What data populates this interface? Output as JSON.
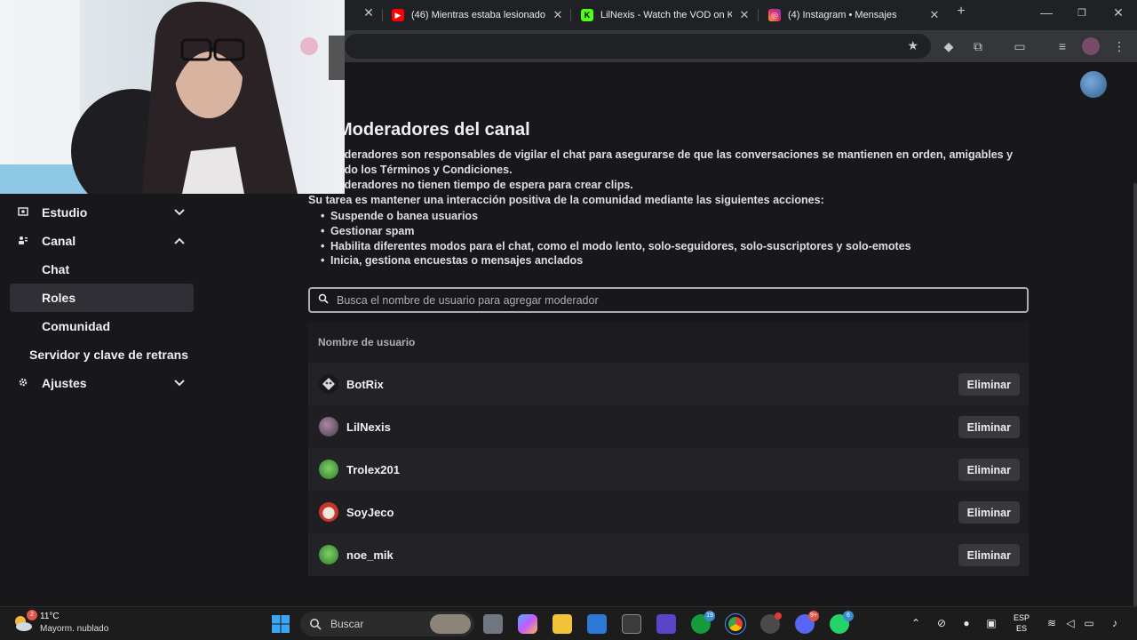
{
  "browser": {
    "tabs": [
      {
        "title": "(46) Mientras estaba lesionado",
        "favicon": "youtube-icon",
        "color": "#ff0000"
      },
      {
        "title": "LilNexis - Watch the VOD on Ki",
        "favicon": "kick-icon",
        "color": "#53fc18"
      },
      {
        "title": "(4) Instagram • Mensajes",
        "favicon": "instagram-icon",
        "color": "#e1306c"
      }
    ],
    "new_tab": "+",
    "window_controls": [
      "minimize-icon",
      "restore-icon",
      "close-icon"
    ]
  },
  "sidebar": {
    "items": [
      {
        "label": "Estudio",
        "icon": "studio-icon",
        "expanded": false
      },
      {
        "label": "Canal",
        "icon": "channel-icon",
        "expanded": true
      },
      {
        "label": "Chat"
      },
      {
        "label": "Roles",
        "active": true
      },
      {
        "label": "Comunidad"
      },
      {
        "label": "Servidor y clave de retrans"
      },
      {
        "label": "Ajustes",
        "icon": "gear-icon",
        "expanded": false
      }
    ]
  },
  "main": {
    "title": "Moderadores del canal",
    "desc": [
      "oderadores son responsables de vigilar el chat para asegurarse de que las conversaciones se mantienen en orden, amigables y",
      "ndo los Términos y Condiciones.",
      "oderadores no tienen tiempo de espera para crear clips.",
      "Su tarea es mantener una interacción positiva de la comunidad mediante las siguientes acciones:"
    ],
    "bullets": [
      "Suspende o banea usuarios",
      "Gestionar spam",
      "Habilita diferentes modos para el chat, como el modo lento, solo-seguidores, solo-suscriptores y solo-emotes",
      "Inicia, gestiona encuestas o mensajes anclados"
    ],
    "search": {
      "placeholder": "Busca el nombre de usuario para agregar moderador",
      "value": ""
    },
    "table": {
      "header": "Nombre de usuario",
      "remove_label": "Eliminar",
      "rows": [
        {
          "username": "BotRix",
          "avatar_color": "#d7d7dc"
        },
        {
          "username": "LilNexis",
          "avatar_color": "#6b5a70"
        },
        {
          "username": "Trolex201",
          "avatar_color": "#4fa13a"
        },
        {
          "username": "SoyJeco",
          "avatar_color": "#c8352b"
        },
        {
          "username": "noe_mik",
          "avatar_color": "#4fa13a"
        }
      ]
    }
  },
  "taskbar": {
    "weather": {
      "temp": "11°C",
      "desc": "Mayorm. nublado",
      "badge": "2"
    },
    "search_label": "Buscar",
    "badges": {
      "xbox": "19",
      "discord": "9+",
      "whatsapp": "6"
    },
    "lang_top": "ESP",
    "lang_bottom": "ES"
  }
}
